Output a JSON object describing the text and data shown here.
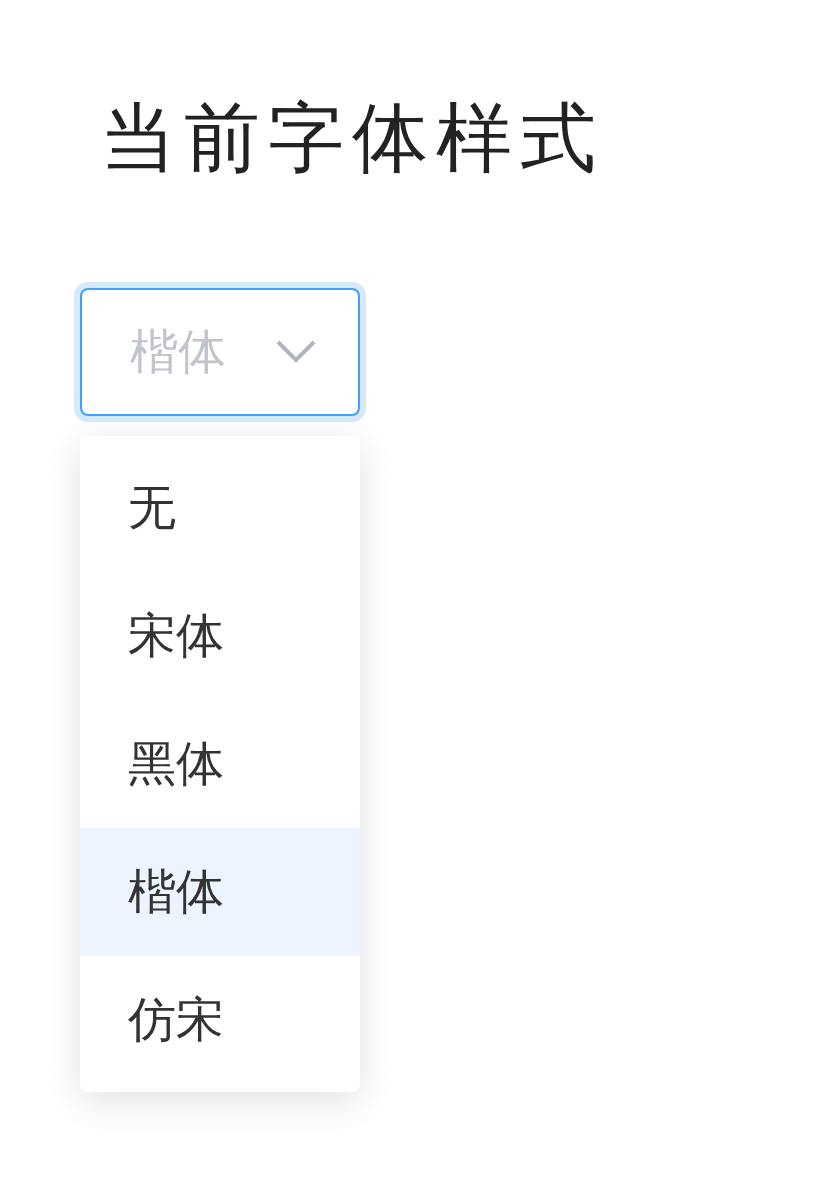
{
  "title": "当前字体样式",
  "select": {
    "placeholder": "楷体",
    "expanded": true,
    "options": [
      {
        "label": "无",
        "selected": false
      },
      {
        "label": "宋体",
        "selected": false
      },
      {
        "label": "黑体",
        "selected": false
      },
      {
        "label": "楷体",
        "selected": true
      },
      {
        "label": "仿宋",
        "selected": false
      }
    ]
  }
}
